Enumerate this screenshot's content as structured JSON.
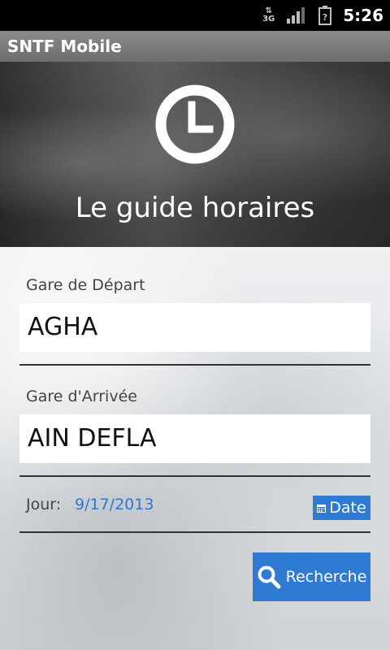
{
  "status_bar": {
    "network_type": "3G",
    "time": "5:26"
  },
  "app_bar": {
    "title": "SNTF Mobile"
  },
  "hero": {
    "title": "Le guide horaires",
    "icon": "clock-icon"
  },
  "form": {
    "departure": {
      "label": "Gare de Départ",
      "value": "AGHA"
    },
    "arrival": {
      "label": "Gare d'Arrivée",
      "value": "AIN DEFLA"
    },
    "day": {
      "label": "Jour:",
      "value": "9/17/2013",
      "date_button_label": "Date",
      "date_button_icon": "calendar-icon"
    },
    "search": {
      "label": "Recherche",
      "icon": "magnifier-icon"
    }
  },
  "colors": {
    "accent": "#2f7bd4",
    "date_text": "#2e77d0"
  }
}
